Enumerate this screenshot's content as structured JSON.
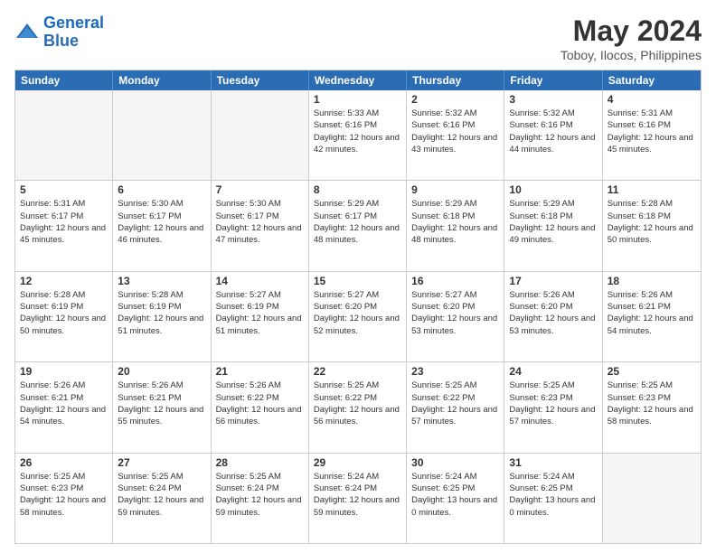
{
  "logo": {
    "text_general": "General",
    "text_blue": "Blue"
  },
  "header": {
    "month_year": "May 2024",
    "location": "Toboy, Ilocos, Philippines"
  },
  "weekdays": [
    "Sunday",
    "Monday",
    "Tuesday",
    "Wednesday",
    "Thursday",
    "Friday",
    "Saturday"
  ],
  "rows": [
    [
      {
        "day": "",
        "empty": true
      },
      {
        "day": "",
        "empty": true
      },
      {
        "day": "",
        "empty": true
      },
      {
        "day": "1",
        "sunrise": "5:33 AM",
        "sunset": "6:16 PM",
        "daylight": "12 hours and 42 minutes."
      },
      {
        "day": "2",
        "sunrise": "5:32 AM",
        "sunset": "6:16 PM",
        "daylight": "12 hours and 43 minutes."
      },
      {
        "day": "3",
        "sunrise": "5:32 AM",
        "sunset": "6:16 PM",
        "daylight": "12 hours and 44 minutes."
      },
      {
        "day": "4",
        "sunrise": "5:31 AM",
        "sunset": "6:16 PM",
        "daylight": "12 hours and 45 minutes."
      }
    ],
    [
      {
        "day": "5",
        "sunrise": "5:31 AM",
        "sunset": "6:17 PM",
        "daylight": "12 hours and 45 minutes."
      },
      {
        "day": "6",
        "sunrise": "5:30 AM",
        "sunset": "6:17 PM",
        "daylight": "12 hours and 46 minutes."
      },
      {
        "day": "7",
        "sunrise": "5:30 AM",
        "sunset": "6:17 PM",
        "daylight": "12 hours and 47 minutes."
      },
      {
        "day": "8",
        "sunrise": "5:29 AM",
        "sunset": "6:17 PM",
        "daylight": "12 hours and 48 minutes."
      },
      {
        "day": "9",
        "sunrise": "5:29 AM",
        "sunset": "6:18 PM",
        "daylight": "12 hours and 48 minutes."
      },
      {
        "day": "10",
        "sunrise": "5:29 AM",
        "sunset": "6:18 PM",
        "daylight": "12 hours and 49 minutes."
      },
      {
        "day": "11",
        "sunrise": "5:28 AM",
        "sunset": "6:18 PM",
        "daylight": "12 hours and 50 minutes."
      }
    ],
    [
      {
        "day": "12",
        "sunrise": "5:28 AM",
        "sunset": "6:19 PM",
        "daylight": "12 hours and 50 minutes."
      },
      {
        "day": "13",
        "sunrise": "5:28 AM",
        "sunset": "6:19 PM",
        "daylight": "12 hours and 51 minutes."
      },
      {
        "day": "14",
        "sunrise": "5:27 AM",
        "sunset": "6:19 PM",
        "daylight": "12 hours and 51 minutes."
      },
      {
        "day": "15",
        "sunrise": "5:27 AM",
        "sunset": "6:20 PM",
        "daylight": "12 hours and 52 minutes."
      },
      {
        "day": "16",
        "sunrise": "5:27 AM",
        "sunset": "6:20 PM",
        "daylight": "12 hours and 53 minutes."
      },
      {
        "day": "17",
        "sunrise": "5:26 AM",
        "sunset": "6:20 PM",
        "daylight": "12 hours and 53 minutes."
      },
      {
        "day": "18",
        "sunrise": "5:26 AM",
        "sunset": "6:21 PM",
        "daylight": "12 hours and 54 minutes."
      }
    ],
    [
      {
        "day": "19",
        "sunrise": "5:26 AM",
        "sunset": "6:21 PM",
        "daylight": "12 hours and 54 minutes."
      },
      {
        "day": "20",
        "sunrise": "5:26 AM",
        "sunset": "6:21 PM",
        "daylight": "12 hours and 55 minutes."
      },
      {
        "day": "21",
        "sunrise": "5:26 AM",
        "sunset": "6:22 PM",
        "daylight": "12 hours and 56 minutes."
      },
      {
        "day": "22",
        "sunrise": "5:25 AM",
        "sunset": "6:22 PM",
        "daylight": "12 hours and 56 minutes."
      },
      {
        "day": "23",
        "sunrise": "5:25 AM",
        "sunset": "6:22 PM",
        "daylight": "12 hours and 57 minutes."
      },
      {
        "day": "24",
        "sunrise": "5:25 AM",
        "sunset": "6:23 PM",
        "daylight": "12 hours and 57 minutes."
      },
      {
        "day": "25",
        "sunrise": "5:25 AM",
        "sunset": "6:23 PM",
        "daylight": "12 hours and 58 minutes."
      }
    ],
    [
      {
        "day": "26",
        "sunrise": "5:25 AM",
        "sunset": "6:23 PM",
        "daylight": "12 hours and 58 minutes."
      },
      {
        "day": "27",
        "sunrise": "5:25 AM",
        "sunset": "6:24 PM",
        "daylight": "12 hours and 59 minutes."
      },
      {
        "day": "28",
        "sunrise": "5:25 AM",
        "sunset": "6:24 PM",
        "daylight": "12 hours and 59 minutes."
      },
      {
        "day": "29",
        "sunrise": "5:24 AM",
        "sunset": "6:24 PM",
        "daylight": "12 hours and 59 minutes."
      },
      {
        "day": "30",
        "sunrise": "5:24 AM",
        "sunset": "6:25 PM",
        "daylight": "13 hours and 0 minutes."
      },
      {
        "day": "31",
        "sunrise": "5:24 AM",
        "sunset": "6:25 PM",
        "daylight": "13 hours and 0 minutes."
      },
      {
        "day": "",
        "empty": true
      }
    ]
  ]
}
